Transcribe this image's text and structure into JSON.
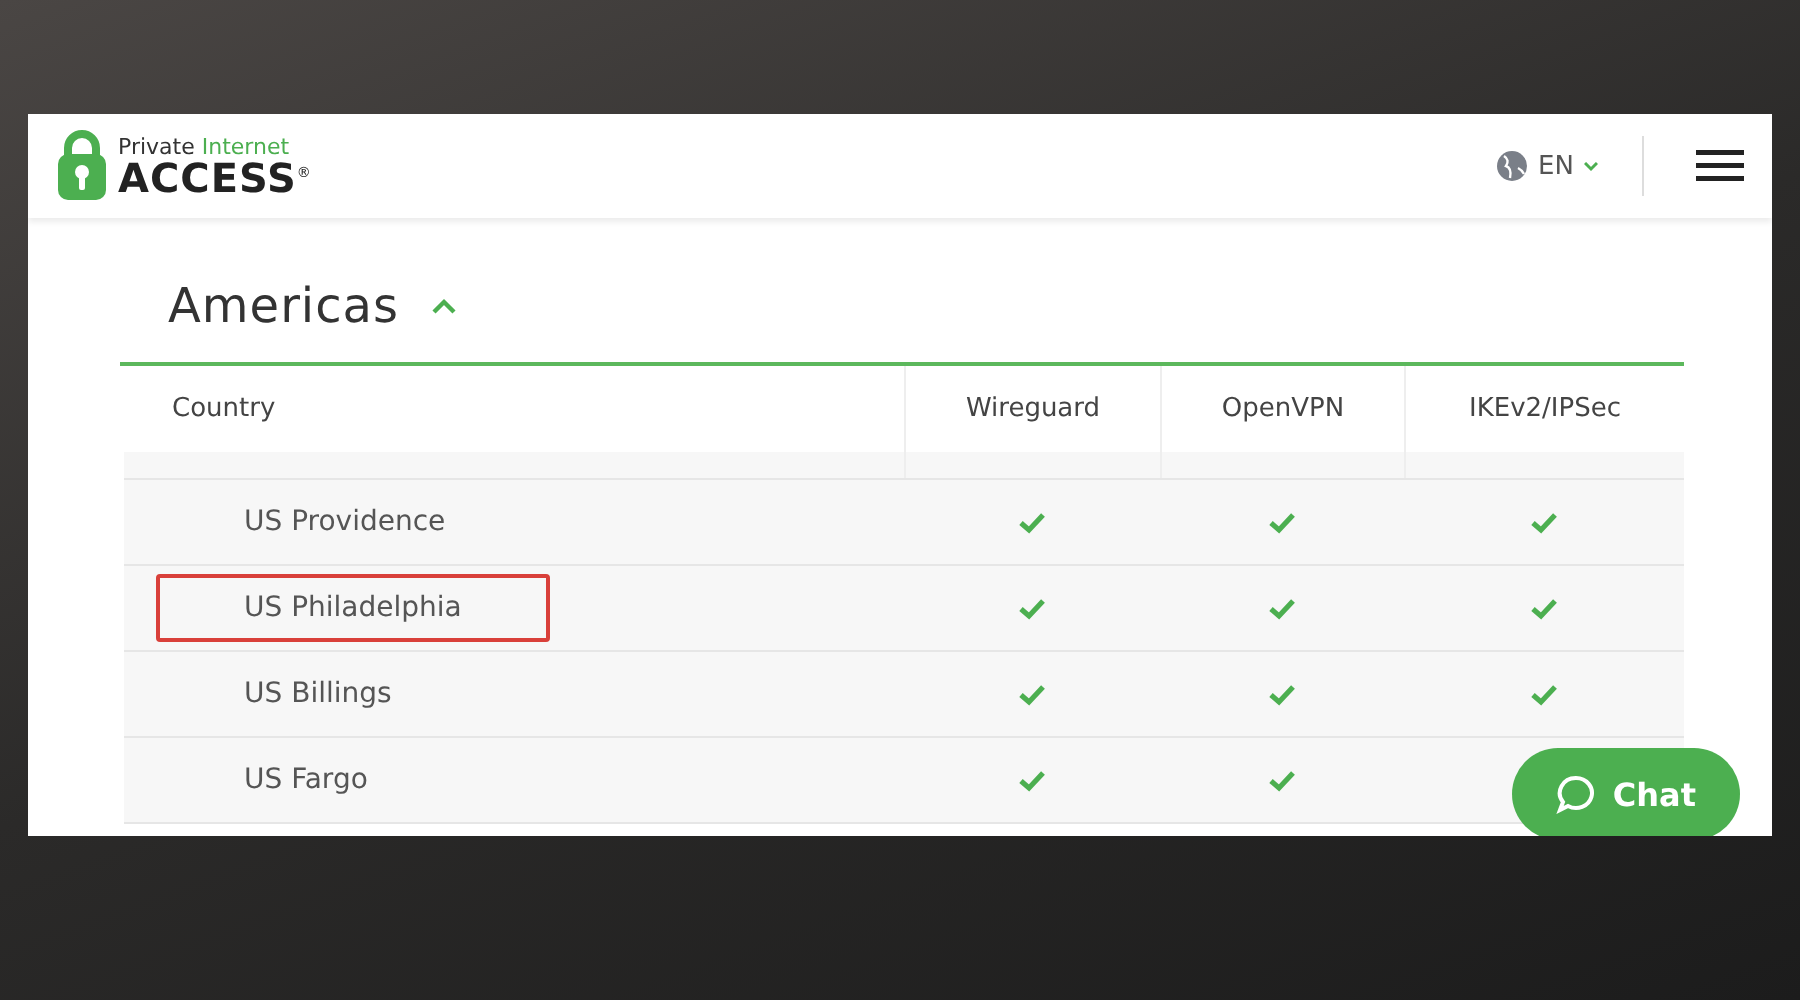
{
  "header": {
    "logo": {
      "line1_a": "Private",
      "line1_b": "Internet",
      "line2": "ACCESS",
      "mark": "®"
    },
    "language": "EN"
  },
  "section": {
    "title": "Americas",
    "expanded": true
  },
  "table": {
    "columns": [
      "Country",
      "Wireguard",
      "OpenVPN",
      "IKEv2/IPSec"
    ],
    "rows": [
      {
        "country": "US Providence",
        "wireguard": true,
        "openvpn": true,
        "ikev2": true,
        "highlighted": false
      },
      {
        "country": "US Philadelphia",
        "wireguard": true,
        "openvpn": true,
        "ikev2": true,
        "highlighted": true
      },
      {
        "country": "US Billings",
        "wireguard": true,
        "openvpn": true,
        "ikev2": true,
        "highlighted": false
      },
      {
        "country": "US Fargo",
        "wireguard": true,
        "openvpn": true,
        "highlighted": false
      }
    ]
  },
  "chat_button": "Chat"
}
